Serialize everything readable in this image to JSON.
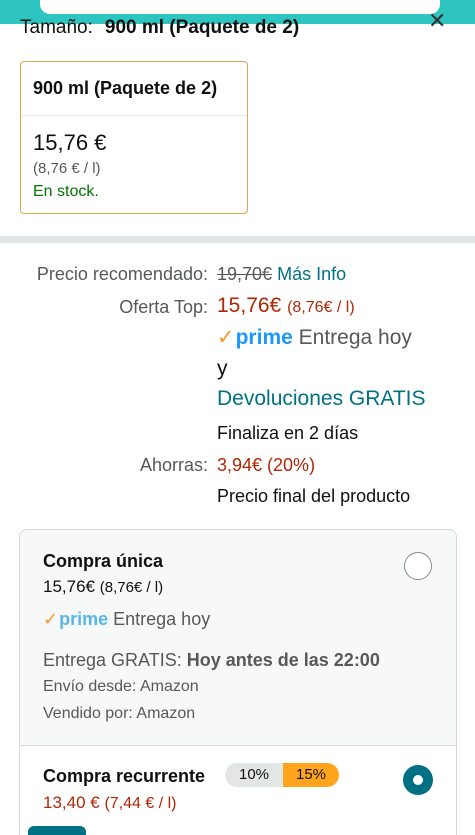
{
  "header": {
    "size_label": "Tamaño:",
    "size_value": "900 ml (Paquete de 2)",
    "close_icon": "close-icon"
  },
  "variant": {
    "title": "900 ml (Paquete de 2)",
    "price": "15,76 €",
    "unit_price": "(8,76 € / l)",
    "stock": "En stock."
  },
  "pricing": {
    "rrp_label": "Precio recomendado:",
    "rrp_value": "19,70€",
    "more_info": "Más Info",
    "deal_label": "Oferta Top:",
    "deal_price": "15,76€",
    "deal_unit": "(8,76€ / l)",
    "prime": "prime",
    "delivery": "Entrega hoy",
    "and": "y",
    "returns": "Devoluciones GRATIS",
    "ends": "Finaliza en 2 días",
    "savings_label": "Ahorras:",
    "savings_value": "3,94€ (20%)",
    "final_price": "Precio final del producto"
  },
  "purchase_options": {
    "one_time": {
      "title": "Compra única",
      "price": "15,76€",
      "unit": "(8,76€ / l)",
      "prime": "prime",
      "delivery": "Entrega hoy",
      "free_delivery_label": "Entrega GRATIS:",
      "free_delivery_time": "Hoy antes de las 22:00",
      "ships_from": "Envío desde: Amazon",
      "sold_by": "Vendido por: Amazon",
      "selected": false
    },
    "recurring": {
      "title": "Compra recurrente",
      "discount_low": "10%",
      "discount_high": "15%",
      "price": "13,40 €",
      "unit": "(7,44 € / l)",
      "selected": true
    }
  },
  "colors": {
    "link": "#007185",
    "price_red": "#b12704",
    "stock_green": "#007600",
    "prime_blue": "#1a98ff",
    "prime_check": "#f39b2d",
    "selected_border": "#d9a94b",
    "radio_selected": "#007185",
    "pill_orange": "#ffa41c"
  }
}
